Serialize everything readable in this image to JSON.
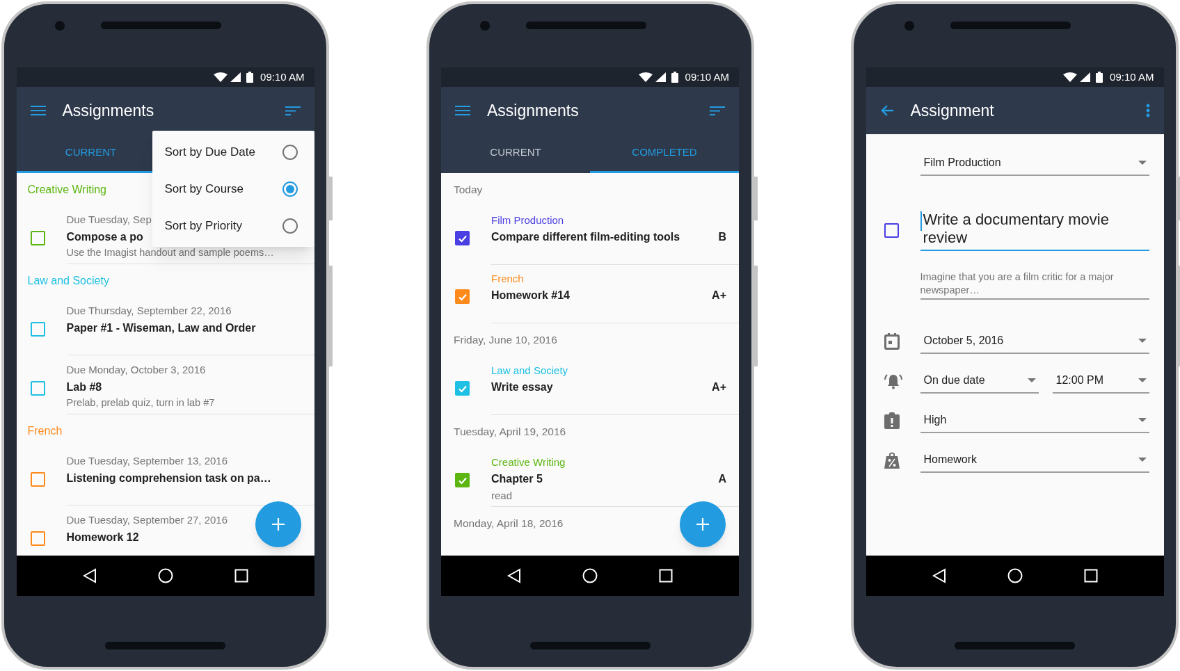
{
  "phones": [
    {
      "kind": "current_list",
      "status": {
        "time": "09:10 AM"
      },
      "app_bar": {
        "title": "Assignments"
      },
      "tabs": [
        {
          "label": "CURRENT",
          "selected": true
        }
      ],
      "sort_menu": [
        {
          "label": "Sort by Due Date",
          "selected": false
        },
        {
          "label": "Sort by Course",
          "selected": true
        },
        {
          "label": "Sort by Priority",
          "selected": false
        }
      ],
      "groups": [
        {
          "heading": "Creative Writing",
          "color": "#5cb60f",
          "items": [
            {
              "due": "Due Tuesday, Sep",
              "title": "Compose a po",
              "description": "Use the Imagist handout and sample poems…",
              "checked": false
            }
          ]
        },
        {
          "heading": "Law and Society",
          "color": "#1ec0e3",
          "items": [
            {
              "due": "Due Thursday, September 22, 2016",
              "title": "Paper #1 - Wiseman, Law and Order",
              "checked": false
            },
            {
              "due": "Due Monday, October 3, 2016",
              "title": "Lab #8",
              "description": "Prelab, prelab quiz, turn in lab #7",
              "checked": false
            }
          ]
        },
        {
          "heading": "French",
          "color": "#ff8a1c",
          "items": [
            {
              "due": "Due Tuesday, September 13, 2016",
              "title": "Listening comprehension task on pa…",
              "checked": false
            },
            {
              "due": "Due Tuesday, September 27, 2016",
              "title": "Homework 12",
              "checked": false
            }
          ]
        }
      ]
    },
    {
      "kind": "completed_list",
      "status": {
        "time": "09:10 AM"
      },
      "app_bar": {
        "title": "Assignments"
      },
      "tabs": [
        {
          "label": "CURRENT",
          "selected": false
        },
        {
          "label": "COMPLETED",
          "selected": true
        }
      ],
      "groups": [
        {
          "heading": "Today",
          "items": [
            {
              "course": "Film Production",
              "color": "#4a3fe3",
              "title": "Compare different film-editing tools",
              "grade": "B",
              "checked": true
            },
            {
              "course": "French",
              "color": "#ff8a1c",
              "title": "Homework #14",
              "grade": "A+",
              "checked": true
            }
          ]
        },
        {
          "heading": "Friday, June 10, 2016",
          "items": [
            {
              "course": "Law and Society",
              "color": "#1ec0e3",
              "title": "Write essay",
              "grade": "A+",
              "checked": true
            }
          ]
        },
        {
          "heading": "Tuesday, April 19, 2016",
          "items": [
            {
              "course": "Creative Writing",
              "color": "#5cb60f",
              "title": "Chapter 5",
              "description": "read",
              "grade": "A",
              "checked": true
            }
          ]
        },
        {
          "heading": "Monday, April 18, 2016"
        }
      ]
    },
    {
      "kind": "detail",
      "status": {
        "time": "09:10 AM"
      },
      "app_bar": {
        "title": "Assignment"
      },
      "course_select": {
        "value": "Film Production"
      },
      "task": {
        "title": "Write a documentary movie review",
        "checked": false,
        "color": "#4a3fe3",
        "focused": true
      },
      "description": "Imagine that you are a film critic for a major newspaper…",
      "fields": [
        {
          "kind": "date",
          "value": "October 5, 2016"
        },
        {
          "kind": "reminder",
          "value": "On due date",
          "time": "12:00 PM"
        },
        {
          "kind": "priority",
          "value": "High"
        },
        {
          "kind": "category",
          "value": "Homework"
        }
      ]
    }
  ]
}
